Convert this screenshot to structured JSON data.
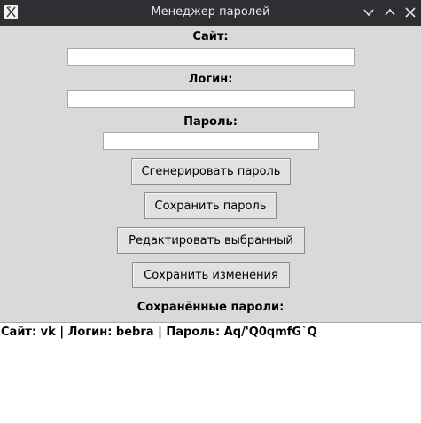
{
  "window": {
    "title": "Менеджер паролей",
    "app_icon": "app-x-icon"
  },
  "form": {
    "site_label": "Сайт:",
    "site_value": "",
    "login_label": "Логин:",
    "login_value": "",
    "password_label": "Пароль:",
    "password_value": ""
  },
  "buttons": {
    "generate": "Сгенерировать пароль",
    "save": "Сохранить пароль",
    "edit": "Редактировать выбранный",
    "save_changes": "Сохранить изменения"
  },
  "saved": {
    "heading": "Сохранённые пароли:",
    "items": [
      "Сайт: vk | Логин: bebra | Пароль: Aq/'Q0qmfG`Q"
    ]
  }
}
